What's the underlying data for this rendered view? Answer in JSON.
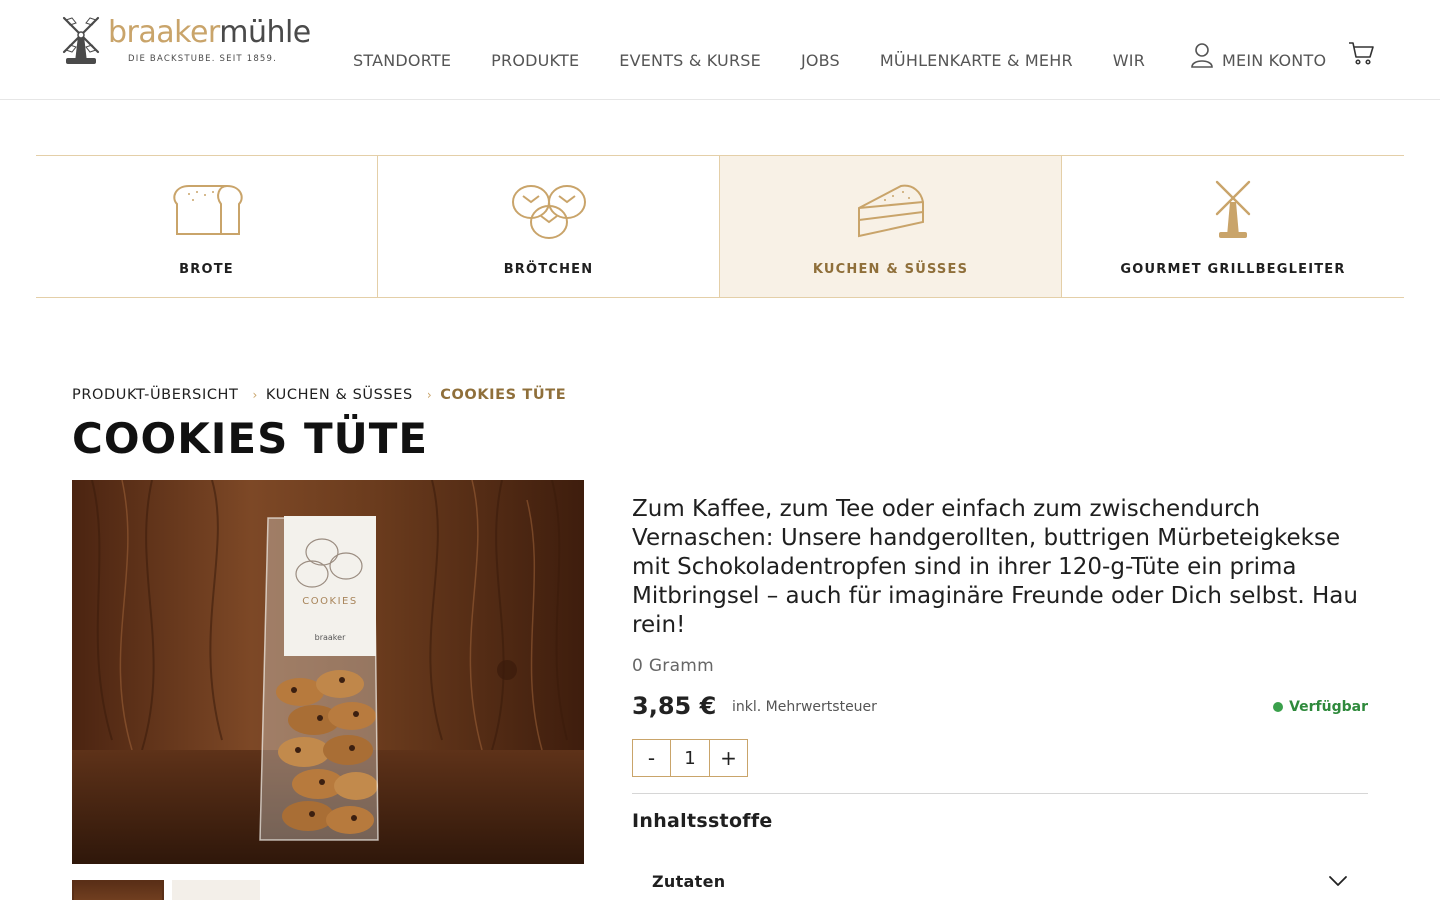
{
  "brand": {
    "name_part1": "braaker",
    "name_part2": "mühle",
    "tagline": "DIE BACKSTUBE. SEIT 1859."
  },
  "nav": {
    "items": [
      {
        "label": "STANDORTE"
      },
      {
        "label": "PRODUKTE"
      },
      {
        "label": "EVENTS & KURSE"
      },
      {
        "label": "JOBS"
      },
      {
        "label": "MÜHLENKARTE & MEHR"
      },
      {
        "label": "WIR"
      }
    ],
    "account_label": "MEIN KONTO"
  },
  "categories": [
    {
      "label": "BROTE",
      "icon": "bread-loaf-icon",
      "active": false
    },
    {
      "label": "BRÖTCHEN",
      "icon": "bread-rolls-icon",
      "active": false
    },
    {
      "label": "KUCHEN & SÜSSES",
      "icon": "cake-slice-icon",
      "active": true
    },
    {
      "label": "GOURMET GRILLBEGLEITER",
      "icon": "windmill-icon",
      "active": false
    }
  ],
  "breadcrumb": {
    "items": [
      "PRODUKT-ÜBERSICHT",
      "KUCHEN & SÜSSES"
    ],
    "current": "COOKIES TÜTE"
  },
  "product": {
    "title": "COOKIES TÜTE",
    "image_bag_label": "COOKIES",
    "description": "Zum Kaffee, zum Tee oder einfach zum zwischendurch Vernaschen: Unsere handgerollten, buttrigen Mürbeteigkekse mit Schokoladentropfen sind in ihrer 120-g-Tüte ein prima Mitbringsel – auch für imaginäre Freunde oder Dich selbst. Hau rein!",
    "weight": "0 Gramm",
    "price": "3,85 €",
    "vat_note": "inkl. Mehrwertsteuer",
    "availability": "Verfügbar",
    "quantity": "1",
    "minus": "-",
    "plus": "+"
  },
  "ingredients": {
    "title": "Inhaltsstoffe",
    "accordion_label": "Zutaten"
  },
  "colors": {
    "accent_gold": "#c9a46a",
    "active_tab_bg": "#f8f1e6",
    "available_green": "#3aa04b"
  }
}
